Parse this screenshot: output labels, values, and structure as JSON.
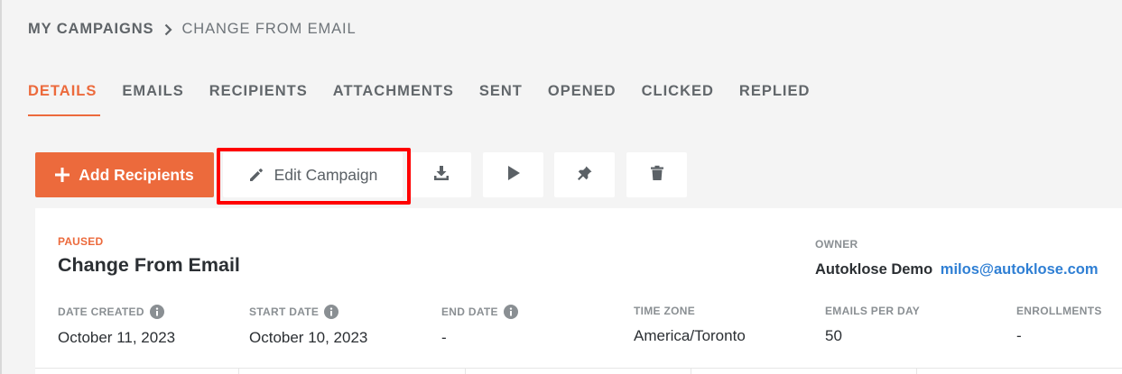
{
  "breadcrumb": {
    "root": "MY CAMPAIGNS",
    "current": "CHANGE FROM EMAIL"
  },
  "tabs": [
    {
      "label": "DETAILS",
      "active": true
    },
    {
      "label": "EMAILS",
      "active": false
    },
    {
      "label": "RECIPIENTS",
      "active": false
    },
    {
      "label": "ATTACHMENTS",
      "active": false
    },
    {
      "label": "SENT",
      "active": false
    },
    {
      "label": "OPENED",
      "active": false
    },
    {
      "label": "CLICKED",
      "active": false
    },
    {
      "label": "REPLIED",
      "active": false
    }
  ],
  "toolbar": {
    "add_label": "Add Recipients",
    "edit_label": "Edit Campaign",
    "icons": [
      "download-icon",
      "play-icon",
      "pin-icon",
      "trash-icon"
    ]
  },
  "campaign": {
    "status": "PAUSED",
    "title": "Change From Email",
    "owner_label": "OWNER",
    "owner_name": "Autoklose Demo",
    "owner_email": "milos@autoklose.com",
    "fields": [
      {
        "label": "DATE CREATED",
        "value": "October 11, 2023",
        "info": true
      },
      {
        "label": "START DATE",
        "value": "October 10, 2023",
        "info": true
      },
      {
        "label": "END DATE",
        "value": "-",
        "info": true
      },
      {
        "label": "TIME ZONE",
        "value": "America/Toronto",
        "info": false
      },
      {
        "label": "EMAILS PER DAY",
        "value": "50",
        "info": false
      },
      {
        "label": "ENROLLMENTS",
        "value": "-",
        "info": false
      }
    ]
  },
  "colors": {
    "accent": "#ec6a3c",
    "link": "#2f7fd4",
    "highlight": "#ff0000",
    "background": "#f4f4f4"
  }
}
